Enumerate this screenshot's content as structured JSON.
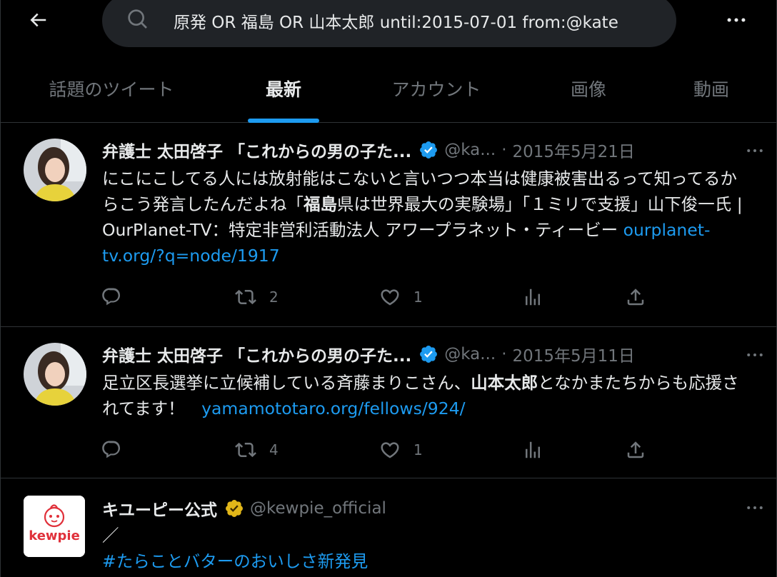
{
  "search": {
    "query": "原発 OR 福島 OR 山本太郎 until:2015-07-01 from:@kate"
  },
  "tabs": [
    {
      "label": "話題のツイート"
    },
    {
      "label": "最新"
    },
    {
      "label": "アカウント"
    },
    {
      "label": "画像"
    },
    {
      "label": "動画"
    }
  ],
  "tweets": [
    {
      "name": "弁護士 太田啓子 「これからの男の子た...",
      "handle": "@ka...",
      "sep": "·",
      "date": "2015年5月21日",
      "text_parts": [
        "にこにこしてる人には放射能はこないと言いつつ本当は健康被害出るって知ってるからこう発言したんだよね「",
        "福島",
        "県は世界最大の実験場」「１ミリで支援」山下俊一氏 | OurPlanet-TV：特定非営利活動法人 アワープラネット・ティービー "
      ],
      "link": "ourplanet-tv.org/?q=node/1917",
      "retweets": "2",
      "likes": "1"
    },
    {
      "name": "弁護士 太田啓子 「これからの男の子た...",
      "handle": "@ka...",
      "sep": "·",
      "date": "2015年5月11日",
      "text_parts": [
        "足立区長選挙に立候補している斉藤まりこさん、",
        "山本太郎",
        "となかまたちからも応援されてます！　"
      ],
      "link": "yamamototaro.org/fellows/924/",
      "retweets": "4",
      "likes": "1"
    },
    {
      "name": "キユーピー公式",
      "handle": "@kewpie_official",
      "line1": "／",
      "hashtag": "#たらことバターのおいしさ新発見",
      "logo_text": "kewpie"
    }
  ],
  "colors": {
    "accent": "#1d9bf0",
    "background": "#000000",
    "muted": "#71767b",
    "gold_badge": "#e2b719"
  }
}
